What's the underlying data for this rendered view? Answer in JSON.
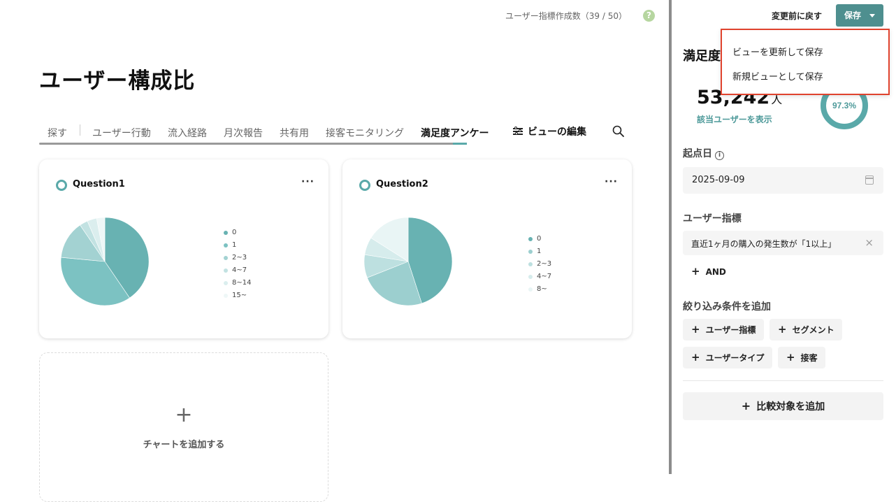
{
  "header": {
    "quota_text": "ユーザー指標作成数（39 / 50）",
    "help_glyph": "?"
  },
  "page": {
    "title": "ユーザー構成比"
  },
  "tabs": [
    {
      "label": "探す"
    },
    {
      "label": "ユーザー行動"
    },
    {
      "label": "流入経路"
    },
    {
      "label": "月次報告"
    },
    {
      "label": "共有用"
    },
    {
      "label": "接客モニタリング"
    },
    {
      "label": "満足度アンケー",
      "active": true
    }
  ],
  "edit_view_label": "ビューの編集",
  "cards": [
    {
      "title": "Question1",
      "more": "···"
    },
    {
      "title": "Question2",
      "more": "···"
    }
  ],
  "chart_data": [
    {
      "type": "pie",
      "title": "Question1",
      "categories": [
        "0",
        "1",
        "2~3",
        "4~7",
        "8~14",
        "15~"
      ],
      "values": [
        40.5,
        36,
        14,
        3,
        3.5,
        3
      ],
      "colors": [
        "#68b2b2",
        "#7cc2c2",
        "#a3d2d2",
        "#c2e2e2",
        "#dbeeee",
        "#eef7f7"
      ]
    },
    {
      "type": "pie",
      "title": "Question2",
      "categories": [
        "0",
        "1",
        "2~3",
        "4~7",
        "8~"
      ],
      "values": [
        45,
        24,
        8.5,
        6.5,
        16
      ],
      "colors": [
        "#68b2b2",
        "#9ccfcf",
        "#bde0e0",
        "#d6ecec",
        "#e9f5f5"
      ]
    }
  ],
  "add_chart": {
    "plus": "+",
    "label": "チャートを追加する"
  },
  "panel": {
    "revert_label": "変更前に戻す",
    "save_label": "保存",
    "title": "満足度",
    "user_count": "53,242",
    "user_unit": "人",
    "show_users_link": "該当ユーザーを表示",
    "gauge_text": "97.3%",
    "gauge_value": 0.973,
    "start_date_label": "起点日",
    "start_date_value": "2025-09-09",
    "user_metric_label": "ユーザー指標",
    "condition_text": "直近1ヶ月の購入の発生数が「1以上」",
    "and_label": "AND",
    "filter_label": "絞り込み条件を追加",
    "filter_buttons": [
      {
        "label": "ユーザー指標"
      },
      {
        "label": "セグメント"
      },
      {
        "label": "ユーザータイプ"
      },
      {
        "label": "接客"
      }
    ],
    "compare_label": "比較対象を追加"
  },
  "save_menu": {
    "items": [
      {
        "label": "ビューを更新して保存"
      },
      {
        "label": "新規ビューとして保存"
      }
    ]
  },
  "colors": {
    "accent": "#4e8f8f",
    "highlight": "#e0432e"
  }
}
